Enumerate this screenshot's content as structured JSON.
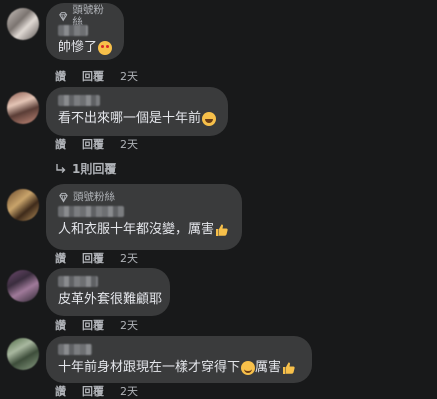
{
  "comments": [
    {
      "badge": "頭號粉絲",
      "text": "帥慘了",
      "emoji": "star-struck-emoji",
      "actions": {
        "like": "讚",
        "reply": "回覆",
        "time": "2天"
      }
    },
    {
      "text": "看不出來哪一個是十年前",
      "emoji": "grinning-emoji",
      "actions": {
        "like": "讚",
        "reply": "回覆",
        "time": "2天"
      },
      "replies_link": "1則回覆"
    },
    {
      "badge": "頭號粉絲",
      "text": "人和衣服十年都沒變，厲害",
      "emoji": "thumbs-up-emoji",
      "actions": {
        "like": "讚",
        "reply": "回覆",
        "time": "2天"
      }
    },
    {
      "text": "皮革外套很難顧耶",
      "actions": {
        "like": "讚",
        "reply": "回覆",
        "time": "2天"
      }
    },
    {
      "text_before": "十年前身材跟現在一樣才穿得下",
      "text_after": "厲害",
      "emojis": [
        "smile-emoji",
        "thumbs-up-emoji"
      ],
      "actions": {
        "like": "讚",
        "reply": "回覆",
        "time": "2天"
      }
    }
  ],
  "colors": {
    "background": "#18191a",
    "bubble": "#3a3b3c",
    "text": "#e4e6eb",
    "secondary": "#b0b3b8"
  }
}
